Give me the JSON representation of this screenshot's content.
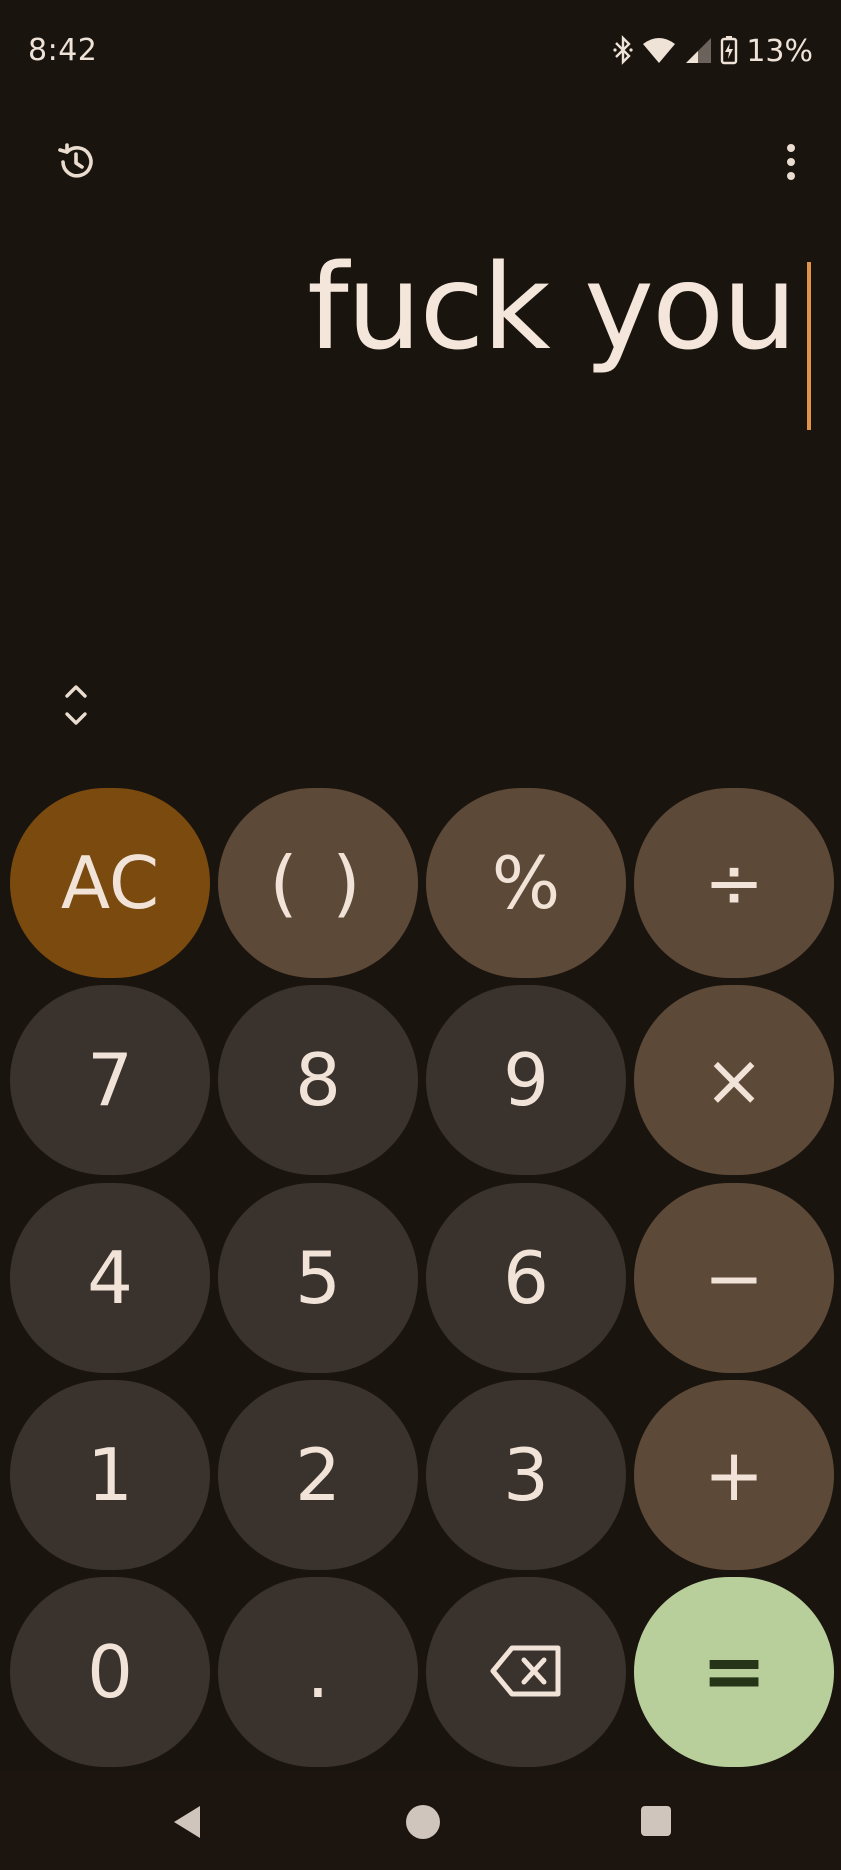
{
  "status_bar": {
    "time": "8:42",
    "battery_percent": "13%",
    "icons": [
      "bluetooth-icon",
      "wifi-icon",
      "signal-icon",
      "battery-charging-icon"
    ]
  },
  "toolbar": {
    "history_icon": "history-icon",
    "more_icon": "more-vertical-icon"
  },
  "display": {
    "expression": "fuck you"
  },
  "keypad": {
    "expand_icon": "expand-collapse-icon",
    "rows": [
      [
        {
          "label": "AC",
          "kind": "ac"
        },
        {
          "label": "( )",
          "kind": "fn"
        },
        {
          "label": "%",
          "kind": "fn"
        },
        {
          "label": "÷",
          "kind": "fn"
        }
      ],
      [
        {
          "label": "7",
          "kind": "num"
        },
        {
          "label": "8",
          "kind": "num"
        },
        {
          "label": "9",
          "kind": "num"
        },
        {
          "label": "×",
          "kind": "fn"
        }
      ],
      [
        {
          "label": "4",
          "kind": "num"
        },
        {
          "label": "5",
          "kind": "num"
        },
        {
          "label": "6",
          "kind": "num"
        },
        {
          "label": "−",
          "kind": "fn"
        }
      ],
      [
        {
          "label": "1",
          "kind": "num"
        },
        {
          "label": "2",
          "kind": "num"
        },
        {
          "label": "3",
          "kind": "num"
        },
        {
          "label": "+",
          "kind": "fn"
        }
      ],
      [
        {
          "label": "0",
          "kind": "num"
        },
        {
          "label": ".",
          "kind": "num"
        },
        {
          "label": "",
          "kind": "num",
          "icon": "backspace-icon"
        },
        {
          "label": "=",
          "kind": "eq"
        }
      ]
    ]
  },
  "nav": {
    "icons": [
      "back-icon",
      "home-icon",
      "recents-icon"
    ]
  },
  "colors": {
    "background": "#1a140f",
    "number_key": "#3a322d",
    "function_key": "#5d4937",
    "clear_key": "#7a4a0e",
    "equals_key": "#b8cf9b",
    "cursor": "#e0944a"
  }
}
